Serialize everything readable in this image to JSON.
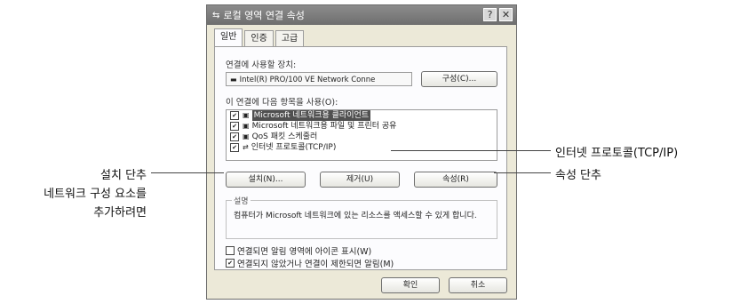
{
  "window": {
    "title": "로컬 영역 연결 속성",
    "help_button": "?",
    "close_button": "✕"
  },
  "tabs": [
    "일반",
    "인증",
    "고급"
  ],
  "general": {
    "connect_using_label": "연결에 사용할 장치:",
    "adapter_name": "Intel(R) PRO/100 VE Network Conne",
    "configure_button": "구성(C)...",
    "items_label": "이 연결에 다음 항목을 사용(O):",
    "items": [
      {
        "label": "Microsoft 네트워크용 클라이언트",
        "checked": true,
        "selected": true
      },
      {
        "label": "Microsoft 네트워크용 파일 및 프린터 공유",
        "checked": true,
        "selected": false
      },
      {
        "label": "QoS 패킷 스케줄러",
        "checked": true,
        "selected": false
      },
      {
        "label": "인터넷 프로토콜(TCP/IP)",
        "checked": true,
        "selected": false
      }
    ],
    "install_button": "설치(N)...",
    "uninstall_button": "제거(U)",
    "properties_button": "속성(R)",
    "description_legend": "설명",
    "description_text": "컴퓨터가 Microsoft 네트워크에 있는 리소스를 액세스할 수 있게 합니다.",
    "show_icon_label": "연결되면 알림 영역에 아이콘 표시(W)",
    "show_icon_checked": false,
    "notify_label": "연결되지 않았거나 연결이 제한되면 알림(M)",
    "notify_checked": true
  },
  "footer": {
    "ok_button": "확인",
    "cancel_button": "취소"
  },
  "annotations": {
    "tcpip": "인터넷 프로토콜(TCP/IP)",
    "properties": "속성 단추",
    "install_title": "설치 단추",
    "install_line1": "네트워크 구성 요소를",
    "install_line2": "추가하려면"
  },
  "colors": {
    "dialog_bg": "#ece9d8",
    "titlebar": "#6e6e6e",
    "selected_item": "#505050"
  }
}
